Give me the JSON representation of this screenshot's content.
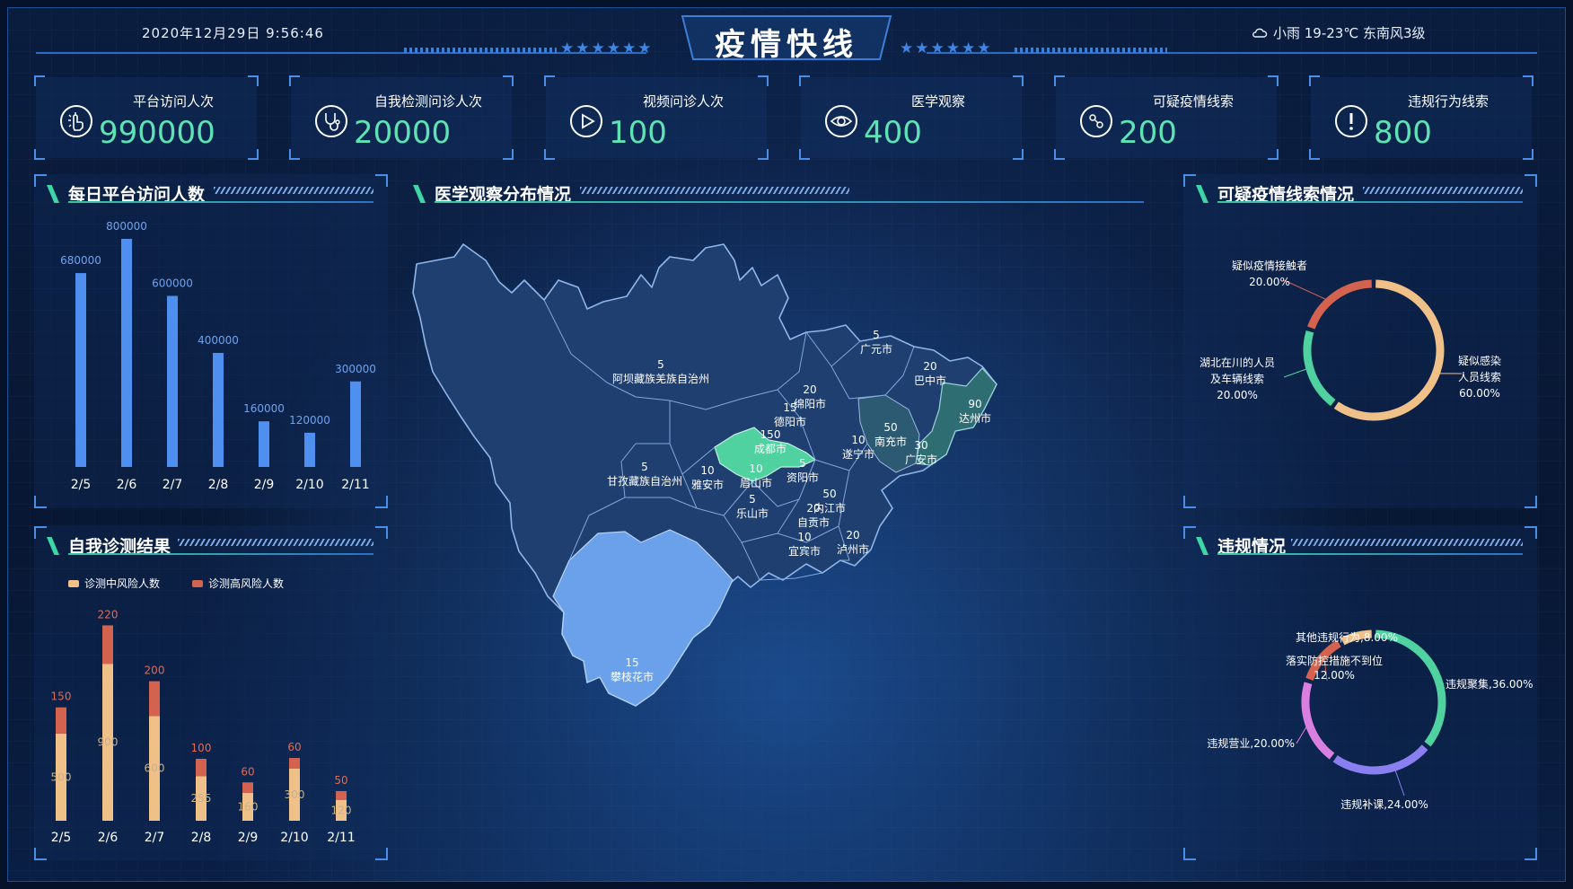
{
  "header": {
    "datetime": "2020年12月29日  9:56:46",
    "title": "疫情快线",
    "weather": "小雨 19-23℃ 东南风3级",
    "stars": "★★★★★★"
  },
  "stats": [
    {
      "label": "平台访问人次",
      "value": "990000",
      "icon": "touch-icon"
    },
    {
      "label": "自我检测问诊人次",
      "value": "20000",
      "icon": "stethoscope-icon"
    },
    {
      "label": "视频问诊人次",
      "value": "100",
      "icon": "play-icon"
    },
    {
      "label": "医学观察",
      "value": "400",
      "icon": "eye-icon"
    },
    {
      "label": "可疑疫情线索",
      "value": "200",
      "icon": "virus-icon"
    },
    {
      "label": "违规行为线索",
      "value": "800",
      "icon": "alert-icon"
    }
  ],
  "panels": {
    "daily_visits": "每日平台访问人数",
    "self_check": "自我诊测结果",
    "map": "医学观察分布情况",
    "clues": "可疑疫情线索情况",
    "violations": "违规情况"
  },
  "colors": {
    "accent_green": "#5fe3b5",
    "bar_blue": "#4f8ff0",
    "medium_risk": "#f0c089",
    "high_risk": "#d3634f",
    "map_fill": "#1e3f70",
    "map_blue": "#6aa1ea",
    "map_teal": "#4fd1a0",
    "map_dark_teal": "#2e6e73"
  },
  "chart_data": [
    {
      "type": "bar",
      "categories": [
        "2/5",
        "2/6",
        "2/7",
        "2/8",
        "2/9",
        "2/10",
        "2/11"
      ],
      "values": [
        680000,
        800000,
        600000,
        400000,
        160000,
        120000,
        300000
      ],
      "title": "每日平台访问人数",
      "ylim": [
        0,
        800000
      ]
    },
    {
      "type": "bar",
      "stacked": true,
      "categories": [
        "2/5",
        "2/6",
        "2/7",
        "2/8",
        "2/9",
        "2/10",
        "2/11"
      ],
      "legend": [
        "诊测中风险人数",
        "诊测高风险人数"
      ],
      "series": [
        {
          "name": "诊测中风险人数",
          "values": [
            500,
            900,
            600,
            255,
            160,
            300,
            120
          ]
        },
        {
          "name": "诊测高风险人数",
          "values": [
            150,
            220,
            200,
            100,
            60,
            60,
            50
          ]
        }
      ],
      "inner_labels": [
        "500",
        "900",
        "600",
        "255",
        "160",
        "300",
        "120"
      ],
      "top_labels": [
        "150",
        "220",
        "200",
        "100",
        "60",
        "60",
        "50"
      ],
      "title": "自我诊测结果",
      "ylim": [
        0,
        1200
      ]
    },
    {
      "type": "pie",
      "title": "可疑疫情线索情况",
      "slices": [
        {
          "name": "疑似感染人员线索",
          "label_lines": [
            "疑似感染",
            "人员线索"
          ],
          "percent": "60.00%",
          "value": 60,
          "color": "#f0c089"
        },
        {
          "name": "湖北在川的人员及车辆线索",
          "label_lines": [
            "湖北在川的人员",
            "及车辆线索"
          ],
          "percent": "20.00%",
          "value": 20,
          "color": "#4fd1a0"
        },
        {
          "name": "疑似疫情接触者",
          "label_lines": [
            "疑似疫情接触者"
          ],
          "percent": "20.00%",
          "value": 20,
          "color": "#d3634f"
        }
      ]
    },
    {
      "type": "pie",
      "title": "违规情况",
      "slices": [
        {
          "name": "违规聚集",
          "label": "违规聚集,36.00%",
          "value": 36,
          "color": "#4fd1a0"
        },
        {
          "name": "违规补课",
          "label": "违规补课,24.00%",
          "value": 24,
          "color": "#8a7ff0"
        },
        {
          "name": "违规营业",
          "label": "违规营业,20.00%",
          "value": 20,
          "color": "#d97fe0"
        },
        {
          "name": "落实防控措施不到位",
          "label_lines": [
            "落实防控措施不到位",
            "12.00%"
          ],
          "value": 12,
          "color": "#d3634f"
        },
        {
          "name": "其他违规行为",
          "label": "其他违规行为,8.00%",
          "value": 8,
          "color": "#f0c089"
        }
      ]
    }
  ],
  "map": {
    "regions": [
      {
        "name": "阿坝藏族羌族自治州",
        "value": "5"
      },
      {
        "name": "甘孜藏族自治州",
        "value": "5"
      },
      {
        "name": "广元市",
        "value": "5"
      },
      {
        "name": "巴中市",
        "value": "20"
      },
      {
        "name": "达州市",
        "value": "90"
      },
      {
        "name": "绵阳市",
        "value": "20"
      },
      {
        "name": "德阳市",
        "value": "15"
      },
      {
        "name": "成都市",
        "value": "150"
      },
      {
        "name": "南充市",
        "value": "50"
      },
      {
        "name": "遂宁市",
        "value": "10"
      },
      {
        "name": "广安市",
        "value": "30"
      },
      {
        "name": "雅安市",
        "value": "10"
      },
      {
        "name": "眉山市",
        "value": "10"
      },
      {
        "name": "资阳市",
        "value": "5"
      },
      {
        "name": "乐山市",
        "value": "5"
      },
      {
        "name": "内江市",
        "value": "50"
      },
      {
        "name": "自贡市",
        "value": "20"
      },
      {
        "name": "宜宾市",
        "value": "10"
      },
      {
        "name": "泸州市",
        "value": "20"
      },
      {
        "name": "攀枝花市",
        "value": "15"
      }
    ]
  }
}
